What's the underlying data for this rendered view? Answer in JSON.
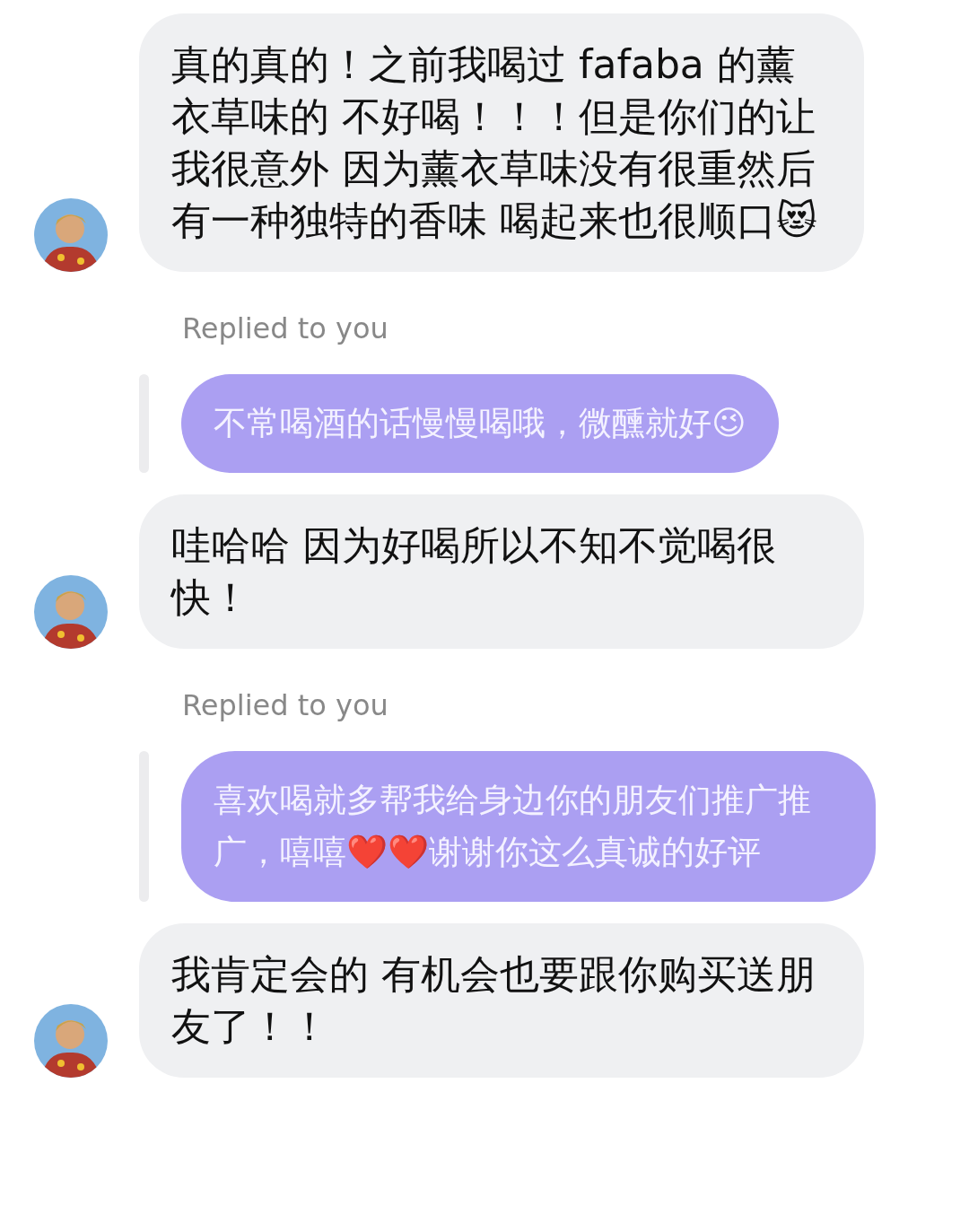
{
  "messages": [
    {
      "kind": "received",
      "text": "真的真的！之前我喝过 fafaba 的薰衣草味的 不好喝！！！但是你们的让我很意外 因为薰衣草味没有很重然后有一种独特的香味 喝起来也很顺口😻"
    },
    {
      "kind": "reply",
      "label": "Replied to you",
      "text": "不常喝酒的话慢慢喝哦，微醺就好😉"
    },
    {
      "kind": "received",
      "text": "哇哈哈 因为好喝所以不知不觉喝很快！"
    },
    {
      "kind": "reply",
      "label": "Replied to you",
      "text": "喜欢喝就多帮我给身边你的朋友们推广推广，嘻嘻❤️❤️谢谢你这么真诚的好评"
    },
    {
      "kind": "received",
      "text": "我肯定会的 有机会也要跟你购买送朋友了！！"
    }
  ]
}
